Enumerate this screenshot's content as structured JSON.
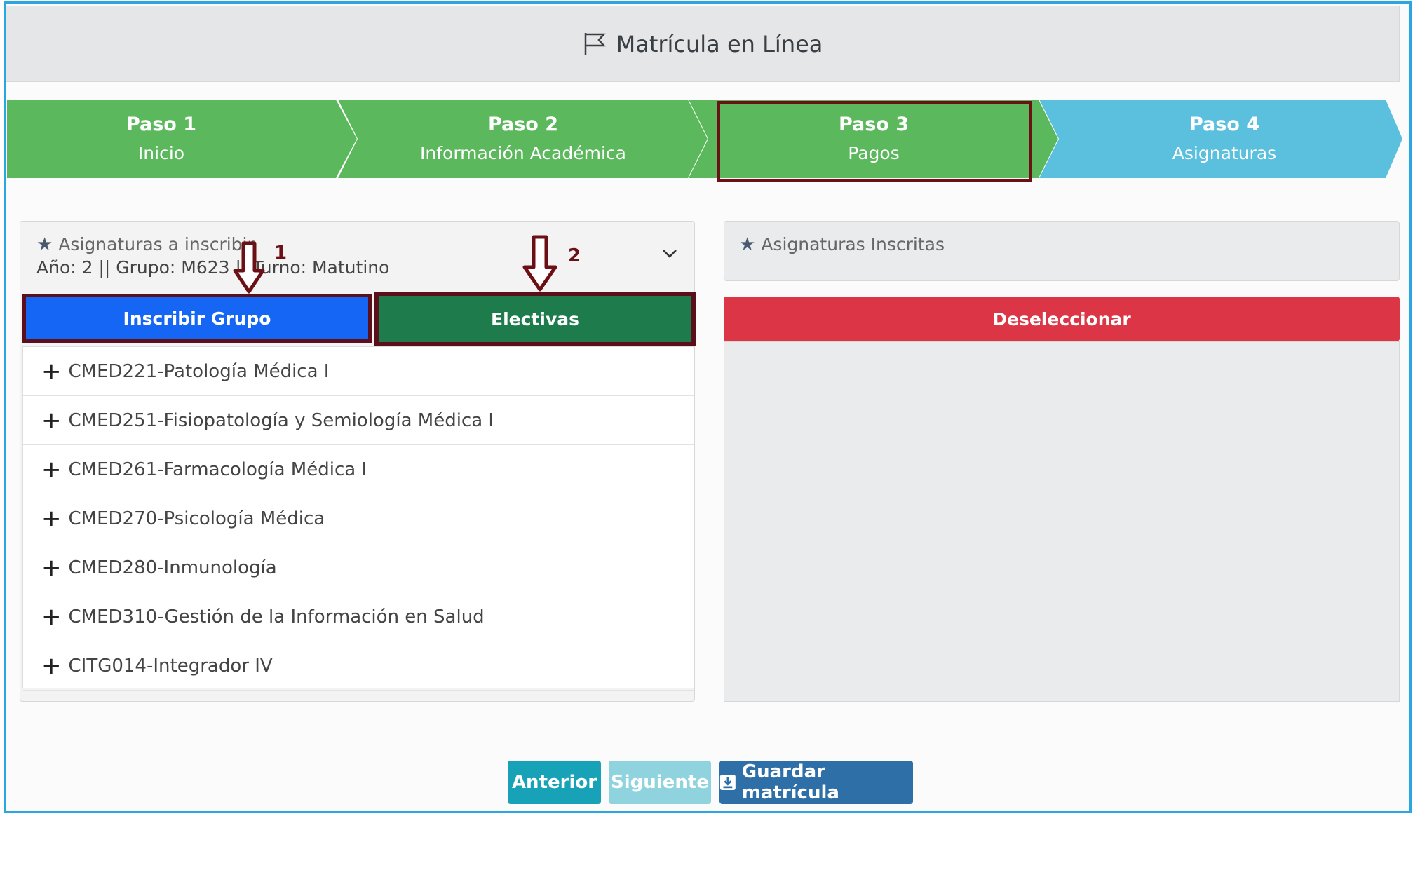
{
  "header": {
    "title": "Matrícula en Línea",
    "icon": "flag-icon"
  },
  "steps": [
    {
      "title": "Paso 1",
      "subtitle": "Inicio",
      "color": "#5cb85c"
    },
    {
      "title": "Paso 2",
      "subtitle": "Información Académica",
      "color": "#5cb85c"
    },
    {
      "title": "Paso 3",
      "subtitle": "Pagos",
      "color": "#5cb85c"
    },
    {
      "title": "Paso 4",
      "subtitle": "Asignaturas",
      "color": "#5bc0de"
    }
  ],
  "left_panel": {
    "title": "Asignaturas a inscribir",
    "subtitle": "Año: 2 || Grupo: M623 || Turno: Matutino",
    "buttons": {
      "inscribir_grupo": "Inscribir Grupo",
      "electivas": "Electivas"
    },
    "subjects": [
      "CMED221-Patología Médica I",
      "CMED251-Fisiopatología y Semiología Médica I",
      "CMED261-Farmacología Médica I",
      "CMED270-Psicología Médica",
      "CMED280-Inmunología",
      "CMED310-Gestión de la Información en Salud",
      "CITG014-Integrador IV"
    ]
  },
  "right_panel": {
    "title": "Asignaturas Inscritas",
    "deselect": "Deseleccionar"
  },
  "annotations": {
    "arrow1": "1",
    "arrow2": "2"
  },
  "footer": {
    "prev": "Anterior",
    "next": "Siguiente",
    "save": "Guardar matrícula"
  },
  "colors": {
    "step_green": "#5cb85c",
    "step_blue": "#5bc0de",
    "primary": "#1566f5",
    "success": "#1e7c4c",
    "danger": "#dc3545",
    "annotation": "#6b1116"
  }
}
